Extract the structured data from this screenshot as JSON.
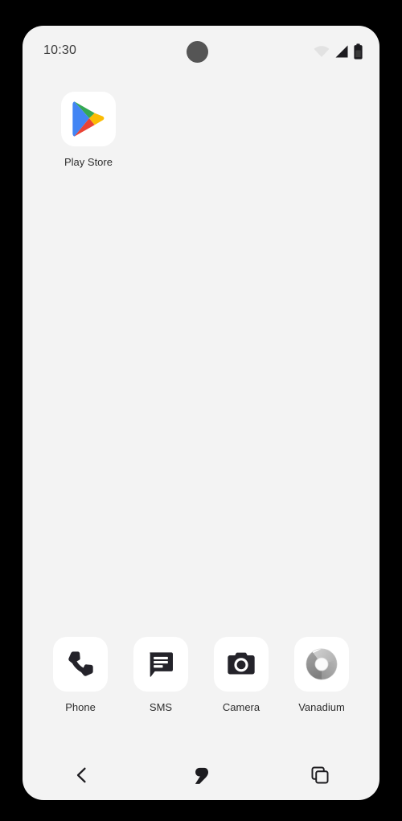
{
  "device": {
    "screen_background": "#f3f3f3",
    "frame_background": "#000000"
  },
  "status_bar": {
    "clock": "10:30",
    "camera_punch_hole": "camera-punch-hole",
    "icons": [
      {
        "name": "wifi-icon",
        "label": "Wi-Fi",
        "color": "#e2e2e2"
      },
      {
        "name": "cellular-icon",
        "label": "Mobile signal",
        "color": "#1c1b1f"
      },
      {
        "name": "battery-icon",
        "label": "Battery",
        "color": "#1c1b1f"
      }
    ]
  },
  "home_screen": {
    "apps": [
      {
        "label": "Play Store",
        "icon": "play-store-icon"
      }
    ]
  },
  "dock": {
    "apps": [
      {
        "label": "Phone",
        "icon": "phone-icon"
      },
      {
        "label": "SMS",
        "icon": "sms-icon"
      },
      {
        "label": "Camera",
        "icon": "camera-icon"
      },
      {
        "label": "Vanadium",
        "icon": "vanadium-icon"
      }
    ]
  },
  "nav_bar": {
    "buttons": [
      {
        "name": "back-button",
        "label": "Back",
        "icon": "back-chevron-icon"
      },
      {
        "name": "home-button",
        "label": "Home",
        "icon": "home-comma-icon"
      },
      {
        "name": "recents-button",
        "label": "Recents",
        "icon": "recents-icon"
      }
    ]
  },
  "colors": {
    "play_store_blue": "#4285f4",
    "play_store_green": "#34a853",
    "play_store_yellow": "#fbbc04",
    "play_store_red": "#ea4335",
    "icon_dark": "#24232a",
    "tile_white": "#ffffff",
    "label_text": "#2e2e2e",
    "nav_icon": "#1c1b1f",
    "vanadium_gray_light": "#c9c9c9",
    "vanadium_gray_mid": "#a8a8a8",
    "vanadium_gray_dark": "#8c8c8c"
  }
}
